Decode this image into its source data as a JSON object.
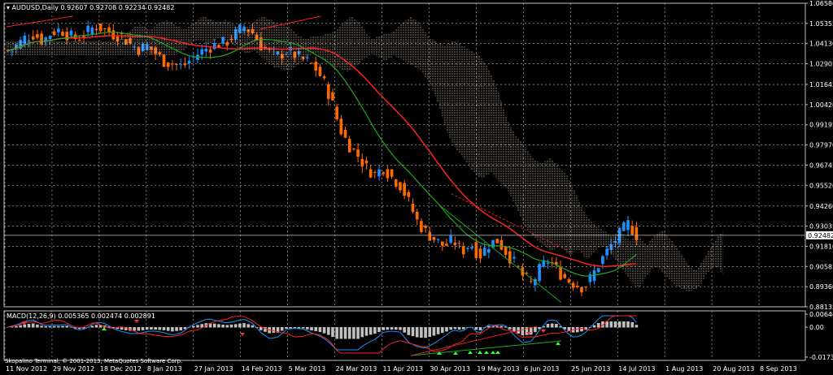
{
  "header": {
    "symbol_label": "AUDUSD,Daily",
    "ohlc": "0.92607 0.92708 0.92234 0.92482"
  },
  "macd": {
    "label": "MACD(12,26,9) 0.005365 0.002474 0.002891"
  },
  "footer": {
    "copyright": "Skopalino Terminal, © 2001-2013, MetaQuotes Software Corp."
  },
  "colors": {
    "background": "#000000",
    "grid": "#c0c0c0",
    "bull_candle": "#1e90ff",
    "bear_candle": "#ff6a00",
    "ma_slow": "#ff2020",
    "ma_fast": "#1faa1f",
    "cloud": "#ffe4c4",
    "macd_hist": "#c0c0c0",
    "macd_line": "#1e90ff",
    "signal_line": "#ff2020",
    "current_price_line": "#c0c0c0"
  },
  "chart_data": {
    "type": "candlestick",
    "title": "AUDUSD,Daily",
    "price_axis_ticks": [
      "1.06580",
      "1.05355",
      "1.04130",
      "1.02905",
      "1.01645",
      "1.00420",
      "0.99195",
      "0.97970",
      "0.96745",
      "0.95520",
      "0.94260",
      "0.93035",
      "0.91810",
      "0.90585",
      "0.89360",
      "0.88135"
    ],
    "current_price": "0.92482",
    "x_tick_labels": [
      "11 Nov 2012",
      "29 Nov 2012",
      "18 Dec 2012",
      "8 Jan 2013",
      "27 Jan 2013",
      "14 Feb 2013",
      "5 Mar 2013",
      "24 Mar 2013",
      "11 Apr 2013",
      "30 Apr 2013",
      "19 May 2013",
      "6 Jun 2013",
      "25 Jun 2013",
      "14 Jul 2013",
      "1 Aug 2013",
      "20 Aug 2013",
      "8 Sep 2013"
    ],
    "close_path": [
      1.037,
      1.04,
      1.045,
      1.047,
      1.043,
      1.048,
      1.05,
      1.046,
      1.044,
      1.048,
      1.052,
      1.05,
      1.047,
      1.046,
      1.041,
      1.038,
      1.04,
      1.035,
      1.03,
      1.029,
      1.027,
      1.032,
      1.036,
      1.039,
      1.041,
      1.042,
      1.047,
      1.052,
      1.048,
      1.04,
      1.036,
      1.034,
      1.037,
      1.034,
      1.031,
      1.028,
      1.02,
      1.008,
      0.99,
      0.98,
      0.974,
      0.966,
      0.962,
      0.966,
      0.96,
      0.955,
      0.944,
      0.932,
      0.926,
      0.922,
      0.918,
      0.922,
      0.915,
      0.92,
      0.912,
      0.919,
      0.922,
      0.915,
      0.908,
      0.9,
      0.895,
      0.905,
      0.91,
      0.903,
      0.898,
      0.895,
      0.893,
      0.901,
      0.91,
      0.918,
      0.925,
      0.932,
      0.925
    ],
    "macd_axis_ticks": [
      "0.006449",
      "0.00",
      "-0.017396"
    ],
    "macd_indicator": "MACD(12,26,9)",
    "macd_values": [
      "0.005365",
      "0.002474",
      "0.002891"
    ]
  }
}
